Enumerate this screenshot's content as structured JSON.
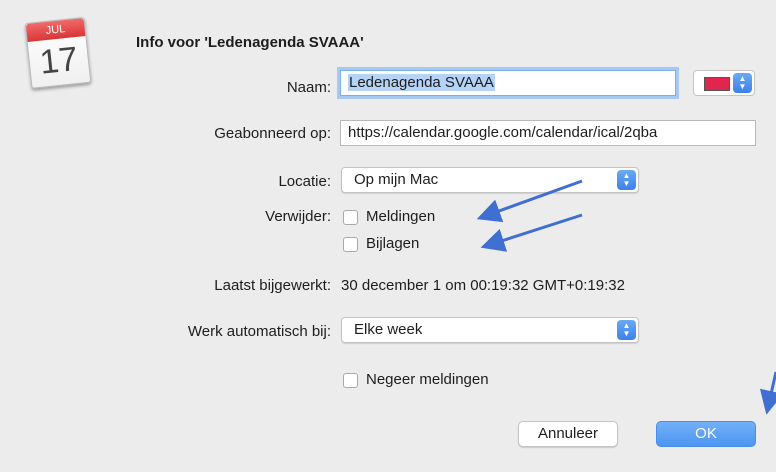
{
  "icon": {
    "month": "JUL",
    "day": "17"
  },
  "dialog": {
    "title": "Info voor 'Ledenagenda SVAAA'"
  },
  "fields": {
    "name": {
      "label": "Naam:",
      "value": "Ledenagenda SVAAA"
    },
    "subscribed": {
      "label": "Geabonneerd op:",
      "value": "https://calendar.google.com/calendar/ical/2qba"
    },
    "location": {
      "label": "Locatie:",
      "value": "Op mijn Mac"
    },
    "remove": {
      "label": "Verwijder:",
      "options": [
        "Meldingen",
        "Bijlagen"
      ]
    },
    "last_updated": {
      "label": "Laatst bijgewerkt:",
      "value": "30 december 1 om 00:19:32 GMT+0:19:32"
    },
    "auto_update": {
      "label": "Werk automatisch bij:",
      "value": "Elke week"
    },
    "ignore_alerts": {
      "label": "Negeer meldingen"
    }
  },
  "colors": {
    "calendar_color": "#e0254e",
    "accent": "#4c95f0",
    "annotation_arrow": "#3f6fd1"
  },
  "buttons": {
    "cancel": "Annuleer",
    "ok": "OK"
  }
}
